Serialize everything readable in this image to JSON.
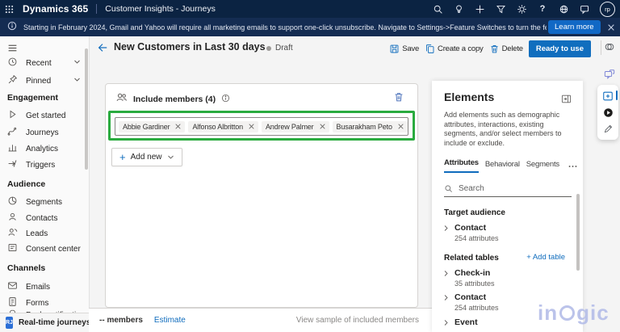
{
  "topbar": {
    "brand": "Dynamics 365",
    "app_name": "Customer Insights - Journeys",
    "help_glyph": "?",
    "avatar_initials": "rp"
  },
  "notification_bar": {
    "message": "Starting in February 2024, Gmail and Yahoo will require all marketing emails to support one-click unsubscribe. Navigate to Settings->Feature Switches to turn the feature on.",
    "learn_more_label": "Learn more"
  },
  "sidebar": {
    "recent_label": "Recent",
    "pinned_label": "Pinned",
    "sections": [
      {
        "title": "Engagement",
        "items": [
          "Get started",
          "Journeys",
          "Analytics",
          "Triggers"
        ]
      },
      {
        "title": "Audience",
        "items": [
          "Segments",
          "Contacts",
          "Leads",
          "Consent center"
        ]
      },
      {
        "title": "Channels",
        "items": [
          "Emails",
          "Forms",
          "Push notifications"
        ]
      }
    ],
    "area_switcher": {
      "initials": "RJ",
      "label": "Real-time journeys"
    }
  },
  "command_bar": {
    "title": "New Customers in Last 30 days",
    "status": "Draft",
    "save_label": "Save",
    "copy_label": "Create a copy",
    "delete_label": "Delete",
    "primary_label": "Ready to use"
  },
  "canvas": {
    "tile_title": "Include members (4)",
    "members": [
      "Abbie Gardiner",
      "Alfonso Albritton",
      "Andrew Palmer",
      "Busarakham Peto"
    ],
    "add_new_label": "Add new",
    "highlight_color": "#2aab3f"
  },
  "footer_bar": {
    "member_count": "-- members",
    "estimate_label": "Estimate",
    "view_sample_label": "View sample of included members"
  },
  "elements_panel": {
    "title": "Elements",
    "description": "Add elements such as demographic attributes, interactions, existing segments, and/or select members to include or exclude.",
    "tabs": [
      "Attributes",
      "Behavioral",
      "Segments"
    ],
    "active_tab": "Attributes",
    "search_placeholder": "Search",
    "target_audience_title": "Target audience",
    "target_audience_items": [
      {
        "name": "Contact",
        "detail": "254 attributes"
      }
    ],
    "related_tables_title": "Related tables",
    "add_table_label": "+ Add table",
    "related_tables_items": [
      {
        "name": "Check-in",
        "detail": "35 attributes"
      },
      {
        "name": "Contact",
        "detail": "254 attributes"
      },
      {
        "name": "Event",
        "detail": ""
      }
    ]
  },
  "watermark": {
    "part1": "in",
    "part2": "gic"
  },
  "colors": {
    "topbar": "#0b2342",
    "notification": "#142c52",
    "accent": "#0f6cbd",
    "primary_button": "#106ebe",
    "highlight_green": "#2aab3f"
  }
}
